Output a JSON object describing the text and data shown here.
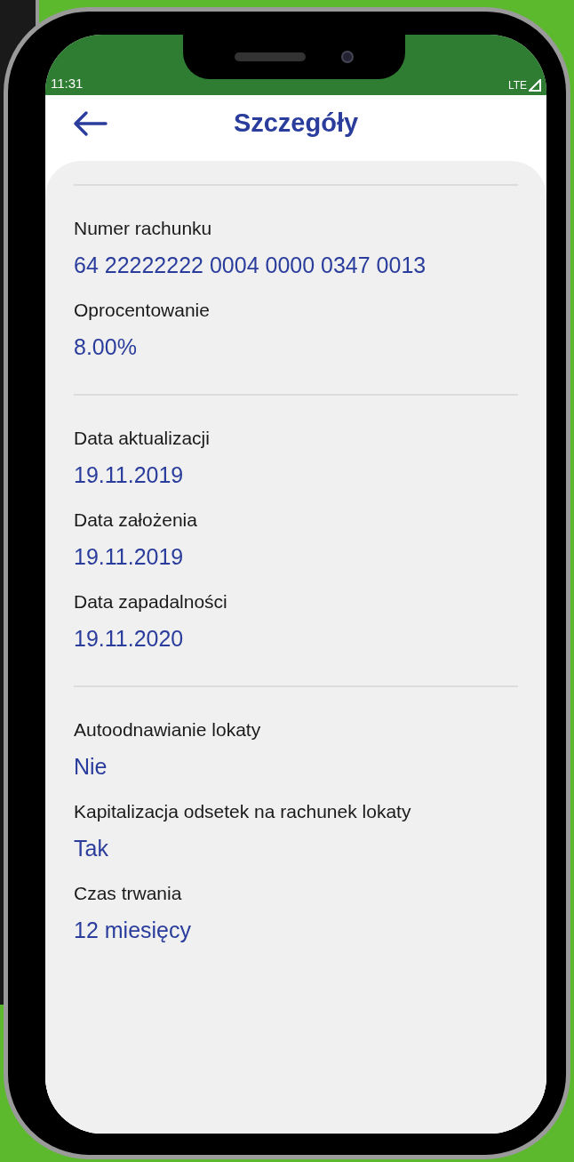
{
  "status_bar": {
    "time": "11:31",
    "network": "LTE"
  },
  "header": {
    "title": "Szczegóły"
  },
  "sections": [
    {
      "fields": [
        {
          "label": "Numer rachunku",
          "value": "64 22222222 0004 0000 0347 0013"
        },
        {
          "label": "Oprocentowanie",
          "value": "8.00%"
        }
      ]
    },
    {
      "fields": [
        {
          "label": "Data aktualizacji",
          "value": "19.11.2019"
        },
        {
          "label": "Data założenia",
          "value": "19.11.2019"
        },
        {
          "label": "Data zapadalności",
          "value": "19.11.2020"
        }
      ]
    },
    {
      "fields": [
        {
          "label": "Autoodnawianie lokaty",
          "value": "Nie"
        },
        {
          "label": "Kapitalizacja odsetek na rachunek lokaty",
          "value": "Tak"
        },
        {
          "label": "Czas trwania",
          "value": "12 miesięcy"
        }
      ]
    }
  ]
}
